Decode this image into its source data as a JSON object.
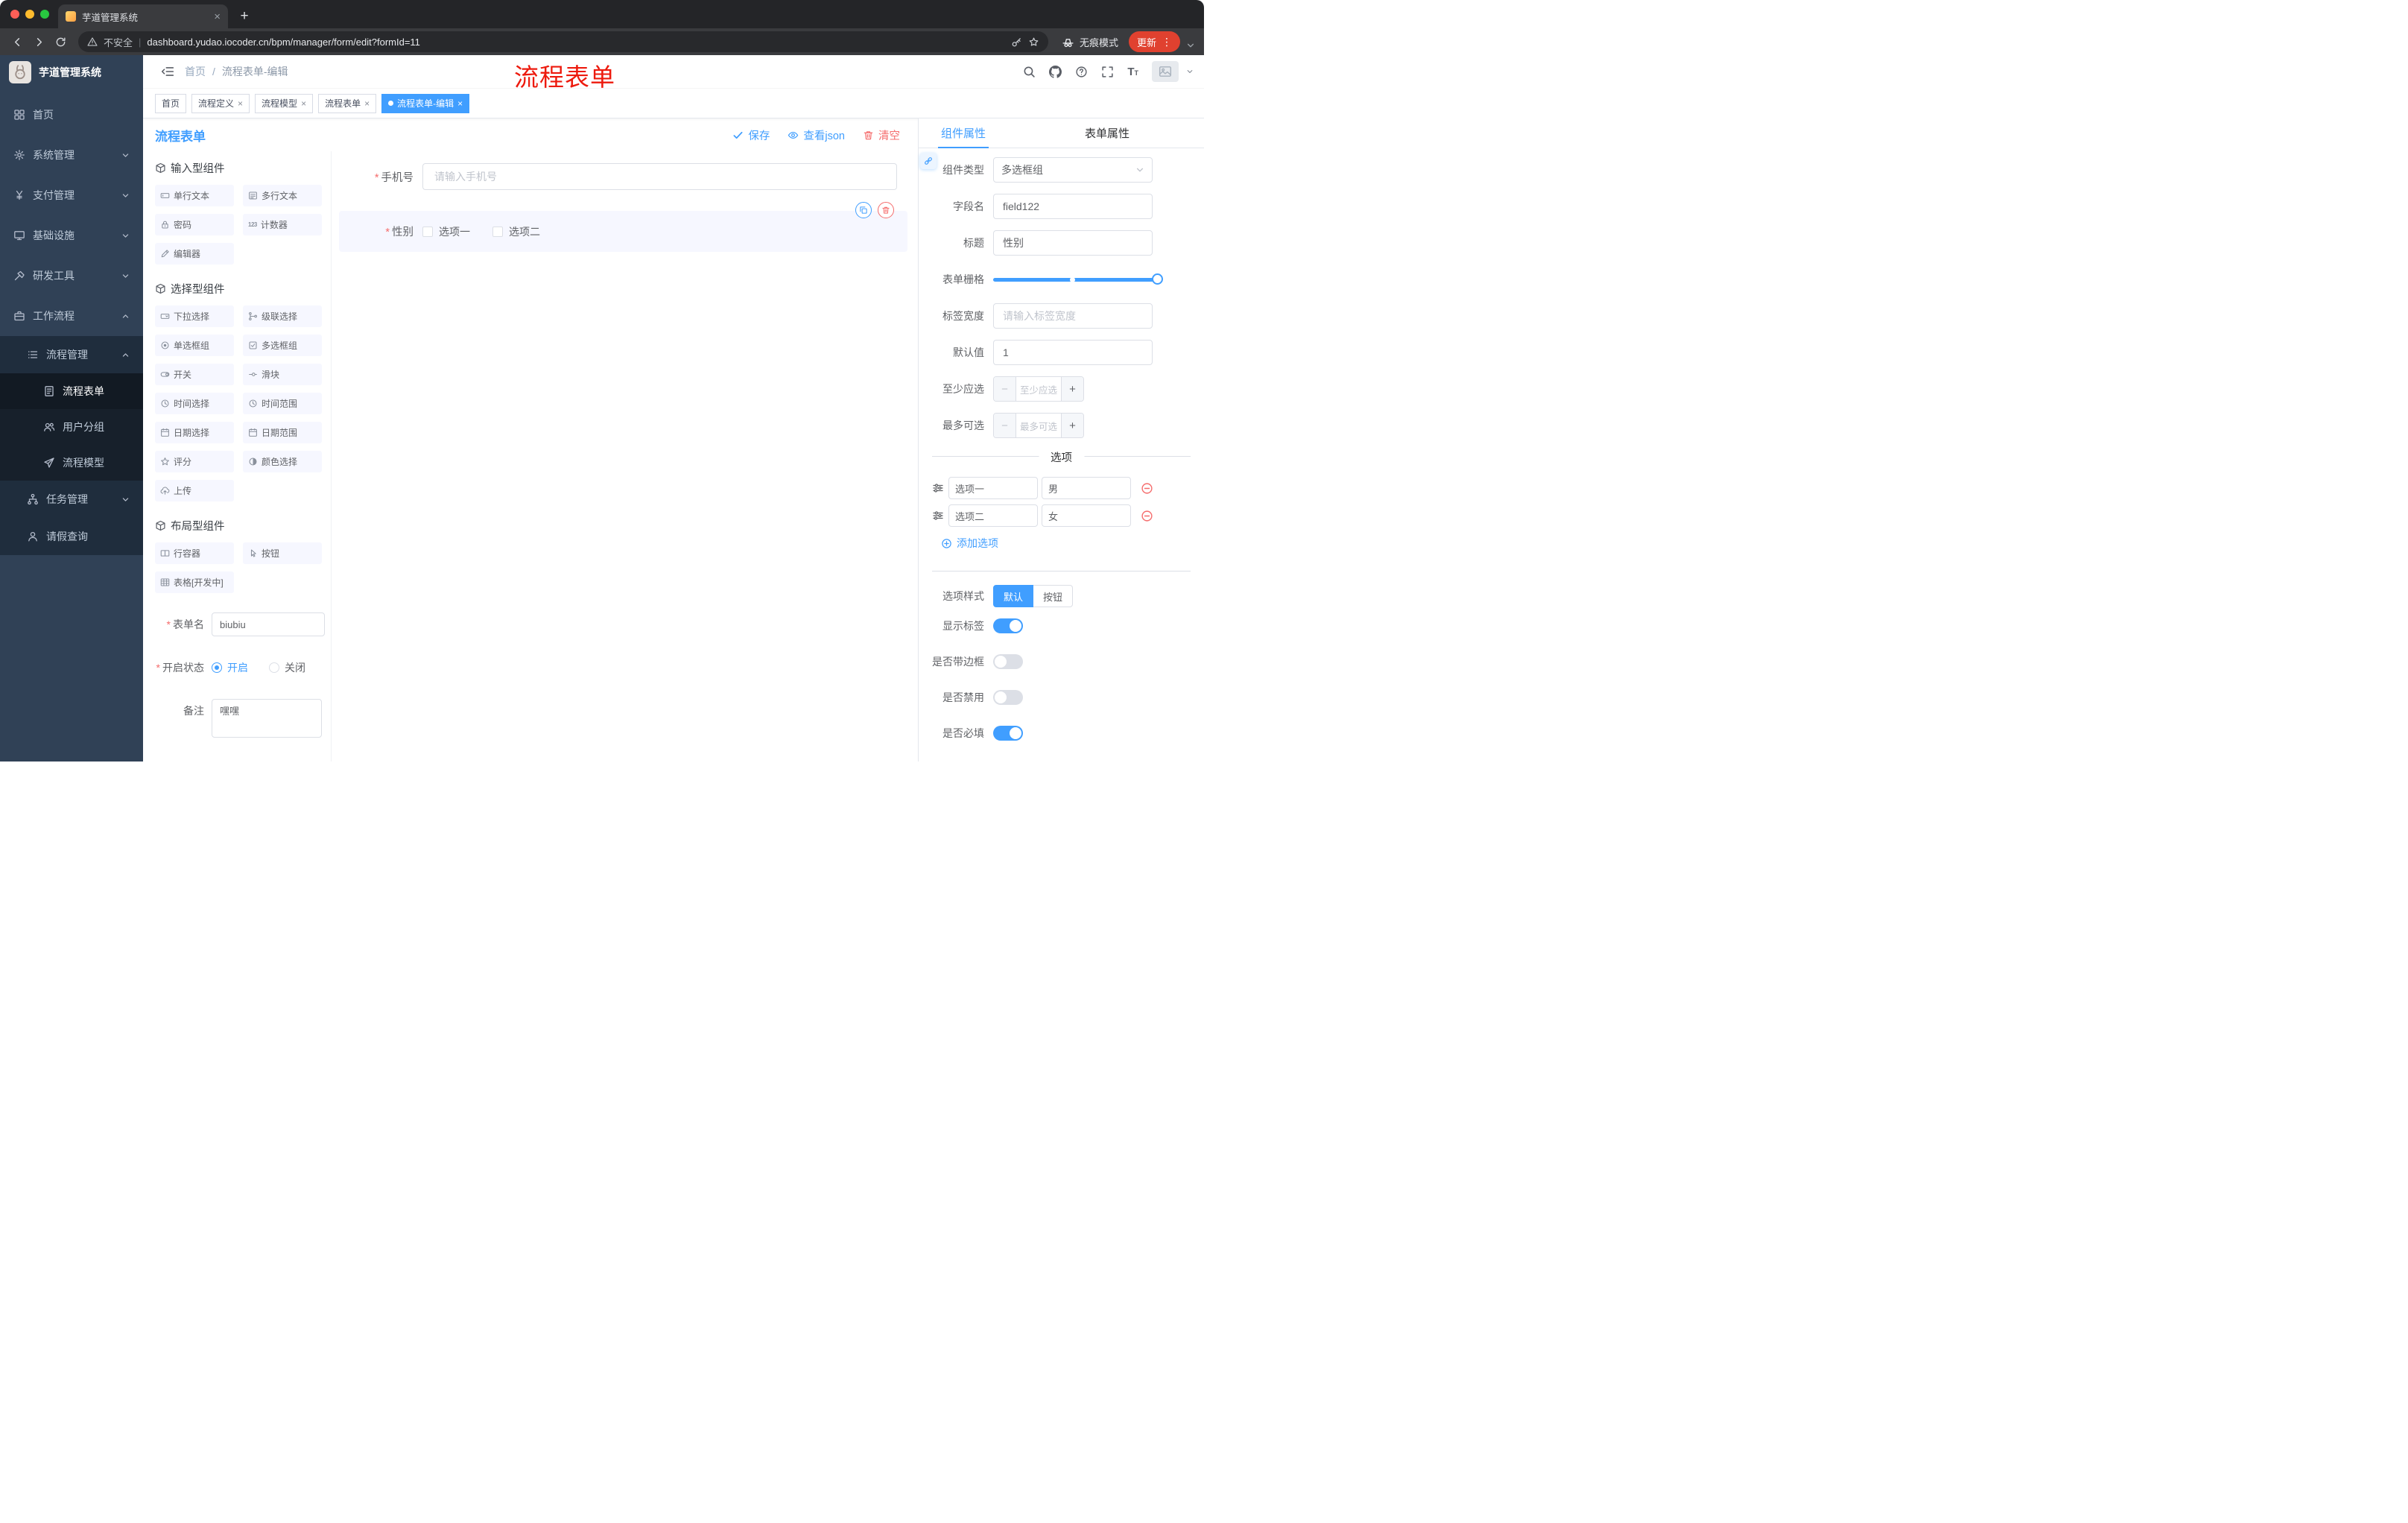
{
  "colors": {
    "accent": "#409eff",
    "danger": "#f56c6c",
    "sidebar_bg": "#304156",
    "annotation": "#ed1a0d",
    "active_tag": "#409eff"
  },
  "browser": {
    "tab_title": "芋道管理系统",
    "security_label": "不安全",
    "url": "dashboard.yudao.iocoder.cn/bpm/manager/form/edit?formId=11",
    "incognito_label": "无痕模式",
    "update_label": "更新"
  },
  "annotation_text": "流程表单",
  "sidebar": {
    "logo_title": "芋道管理系统",
    "items": [
      {
        "label": "首页",
        "icon": "dashboard-icon",
        "level": 1
      },
      {
        "label": "系统管理",
        "icon": "gear-icon",
        "level": 1,
        "expandable": true,
        "expanded": false
      },
      {
        "label": "支付管理",
        "icon": "yen-icon",
        "level": 1,
        "expandable": true,
        "expanded": false
      },
      {
        "label": "基础设施",
        "icon": "monitor-icon",
        "level": 1,
        "expandable": true,
        "expanded": false
      },
      {
        "label": "研发工具",
        "icon": "tool-icon",
        "level": 1,
        "expandable": true,
        "expanded": false
      },
      {
        "label": "工作流程",
        "icon": "briefcase-icon",
        "level": 1,
        "expandable": true,
        "expanded": true
      },
      {
        "label": "流程管理",
        "icon": "list-icon",
        "level": 2,
        "expandable": true,
        "expanded": true
      },
      {
        "label": "流程表单",
        "icon": "document-icon",
        "level": 3,
        "active": true
      },
      {
        "label": "用户分组",
        "icon": "user-group-icon",
        "level": 3
      },
      {
        "label": "流程模型",
        "icon": "send-icon",
        "level": 3
      },
      {
        "label": "任务管理",
        "icon": "tree-icon",
        "level": 2,
        "expandable": true,
        "expanded": false
      },
      {
        "label": "请假查询",
        "icon": "user-icon",
        "level": 2
      }
    ]
  },
  "header": {
    "breadcrumb": {
      "home": "首页",
      "separator": "/",
      "current": "流程表单-编辑"
    }
  },
  "tags": [
    {
      "label": "首页",
      "active": false,
      "closable": false
    },
    {
      "label": "流程定义",
      "active": false,
      "closable": true
    },
    {
      "label": "流程模型",
      "active": false,
      "closable": true
    },
    {
      "label": "流程表单",
      "active": false,
      "closable": true
    },
    {
      "label": "流程表单-编辑",
      "active": true,
      "closable": true
    }
  ],
  "designer": {
    "title": "流程表单",
    "actions": {
      "save": "保存",
      "view_json": "查看json",
      "clear": "清空"
    },
    "palette": {
      "sections": [
        {
          "title": "输入型组件",
          "items": [
            {
              "label": "单行文本",
              "icon": "input-icon"
            },
            {
              "label": "多行文本",
              "icon": "textarea-icon"
            },
            {
              "label": "密码",
              "icon": "lock-icon"
            },
            {
              "label": "计数器",
              "icon": "counter-icon"
            },
            {
              "label": "编辑器",
              "icon": "editor-icon"
            }
          ]
        },
        {
          "title": "选择型组件",
          "items": [
            {
              "label": "下拉选择",
              "icon": "select-icon"
            },
            {
              "label": "级联选择",
              "icon": "cascader-icon"
            },
            {
              "label": "单选框组",
              "icon": "radio-icon"
            },
            {
              "label": "多选框组",
              "icon": "checkbox-icon"
            },
            {
              "label": "开关",
              "icon": "switch-icon"
            },
            {
              "label": "滑块",
              "icon": "slider-icon"
            },
            {
              "label": "时间选择",
              "icon": "time-icon"
            },
            {
              "label": "时间范围",
              "icon": "time-range-icon"
            },
            {
              "label": "日期选择",
              "icon": "date-icon"
            },
            {
              "label": "日期范围",
              "icon": "date-range-icon"
            },
            {
              "label": "评分",
              "icon": "rate-icon"
            },
            {
              "label": "颜色选择",
              "icon": "color-icon"
            },
            {
              "label": "上传",
              "icon": "upload-icon"
            }
          ]
        },
        {
          "title": "布局型组件",
          "items": [
            {
              "label": "行容器",
              "icon": "row-icon"
            },
            {
              "label": "按钮",
              "icon": "button-icon"
            },
            {
              "label": "表格[开发中]",
              "icon": "table-icon"
            }
          ]
        }
      ],
      "form": {
        "name_label": "表单名",
        "name_value": "biubiu",
        "status_label": "开启状态",
        "status_on": "开启",
        "status_off": "关闭",
        "status_value": "开启",
        "remark_label": "备注",
        "remark_value": "嘿嘿"
      }
    },
    "canvas": {
      "phone": {
        "label": "手机号",
        "placeholder": "请输入手机号",
        "required": true,
        "type": "input"
      },
      "gender": {
        "label": "性别",
        "required": true,
        "type": "checkbox-group",
        "options": [
          "选项一",
          "选项二"
        ],
        "selected": true
      }
    }
  },
  "properties": {
    "tabs": [
      "组件属性",
      "表单属性"
    ],
    "active_tab": "组件属性",
    "component_type": {
      "label": "组件类型",
      "value": "多选框组"
    },
    "field_name": {
      "label": "字段名",
      "value": "field122"
    },
    "title_field": {
      "label": "标题",
      "value": "性别"
    },
    "grid": {
      "label": "表单栅格"
    },
    "label_width": {
      "label": "标签宽度",
      "placeholder": "请输入标签宽度"
    },
    "default_value": {
      "label": "默认值",
      "value": "1"
    },
    "min_select": {
      "label": "至少应选",
      "placeholder": "至少应选"
    },
    "max_select": {
      "label": "最多可选",
      "placeholder": "最多可选"
    },
    "options_title": "选项",
    "options": [
      {
        "label": "选项一",
        "value": "男"
      },
      {
        "label": "选项二",
        "value": "女"
      }
    ],
    "add_option_label": "添加选项",
    "option_style": {
      "label": "选项样式",
      "choices": [
        "默认",
        "按钮"
      ],
      "active": "默认"
    },
    "toggles": [
      {
        "label": "显示标签",
        "on": true
      },
      {
        "label": "是否带边框",
        "on": false
      },
      {
        "label": "是否禁用",
        "on": false
      },
      {
        "label": "是否必填",
        "on": true
      }
    ]
  }
}
